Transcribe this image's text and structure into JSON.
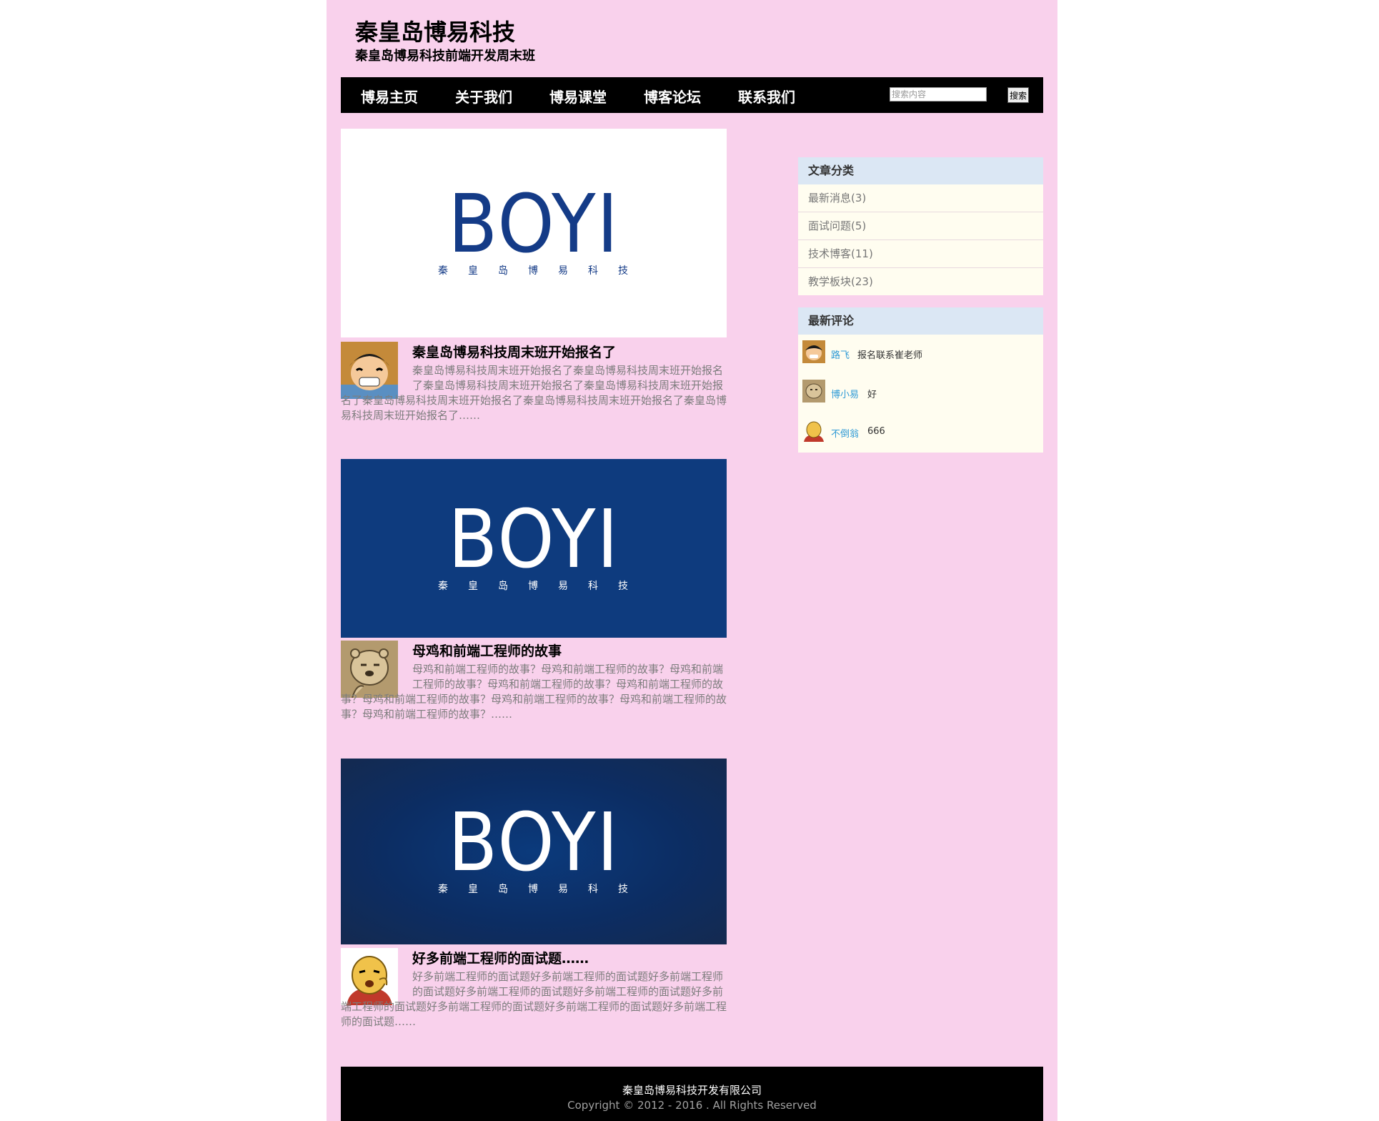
{
  "site": {
    "title": "秦皇岛博易科技",
    "subtitle": "秦皇岛博易科技前端开发周末班"
  },
  "nav": {
    "items": [
      "博易主页",
      "关于我们",
      "博易课堂",
      "博客论坛",
      "联系我们"
    ],
    "search_placeholder": "搜索内容",
    "search_button": "搜索"
  },
  "logo": {
    "word": "BOYI",
    "sub": "秦皇岛博易科技"
  },
  "posts": [
    {
      "title": "秦皇岛博易科技周末班开始报名了",
      "excerpt": "秦皇岛博易科技周末班开始报名了秦皇岛博易科技周末班开始报名了秦皇岛博易科技周末班开始报名了秦皇岛博易科技周末班开始报名了秦皇岛博易科技周末班开始报名了秦皇岛博易科技周末班开始报名了秦皇岛博易科技周末班开始报名了……",
      "avatar_icon": "luffy-avatar-icon"
    },
    {
      "title": "母鸡和前端工程师的故事",
      "excerpt": "母鸡和前端工程师的故事？母鸡和前端工程师的故事？母鸡和前端工程师的故事？母鸡和前端工程师的故事？母鸡和前端工程师的故事？母鸡和前端工程师的故事？母鸡和前端工程师的故事？母鸡和前端工程师的故事？母鸡和前端工程师的故事？……",
      "avatar_icon": "bear-avatar-icon"
    },
    {
      "title": "好多前端工程师的面试题……",
      "excerpt": "好多前端工程师的面试题好多前端工程师的面试题好多前端工程师的面试题好多前端工程师的面试题好多前端工程师的面试题好多前端工程师的面试题好多前端工程师的面试题好多前端工程师的面试题好多前端工程师的面试题……",
      "avatar_icon": "cartoon-man-avatar-icon"
    }
  ],
  "sidebar": {
    "categories_title": "文章分类",
    "categories": [
      "最新消息(3)",
      "面试问题(5)",
      "技术博客(11)",
      "教学板块(23)"
    ],
    "comments_title": "最新评论",
    "comments": [
      {
        "user": "路飞",
        "text": "报名联系崔老师"
      },
      {
        "user": "博小易",
        "text": "好"
      },
      {
        "user": "不倒翁",
        "text": "666"
      }
    ]
  },
  "footer": {
    "company": "秦皇岛博易科技开发有限公司",
    "copyright": "Copyright © 2012 - 2016 . All Rights Reserved"
  },
  "colors": {
    "page_bg": "#f9d1ec",
    "nav_bg": "#000000",
    "banner_blue": "#0e3b7e",
    "banner_navy": "#142a50",
    "logo_blue": "#143b87",
    "panel_head": "#dbe7f4",
    "panel_body": "#fffdf0",
    "comment_user": "#2f9ad6"
  }
}
